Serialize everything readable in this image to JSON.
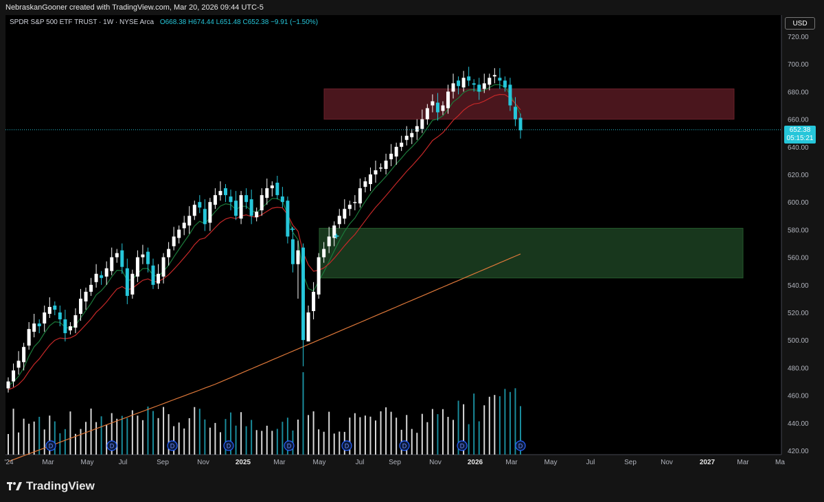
{
  "credit": "NebraskanGooner created with TradingView.com, Mar 20, 2026 09:44 UTC-5",
  "brand": "TradingView",
  "legend": {
    "symbol": "SPDR S&P 500 ETF TRUST · 1W · NYSE Arca",
    "ohlc": "O668.38 H674.44 L651.48 C652.38 −9.91 (−1.50%)"
  },
  "currency": "USD",
  "price_tag": {
    "price": "652.38",
    "countdown": "05:15:21"
  },
  "colors": {
    "up": "#ffffff",
    "down": "#26c6da",
    "ema_fast": "#1b7a3a",
    "ema_mid": "#c62828",
    "ema_slow": "#e0793a",
    "resistance_zone": "#4a161d",
    "support_zone": "#18371d",
    "dividend_marker": "#2962ff",
    "background": "#000000"
  },
  "chart_data": {
    "type": "candlestick",
    "symbol": "SPDR S&P 500 ETF TRUST",
    "interval": "1W",
    "exchange": "NYSE Arca",
    "y_axis": {
      "side": "right",
      "ylim": [
        415,
        728
      ],
      "ticks": [
        420,
        440,
        460,
        480,
        500,
        520,
        540,
        560,
        580,
        600,
        620,
        640,
        660,
        680,
        700,
        720
      ],
      "tick_labels": [
        "420.00",
        "440.00",
        "460.00",
        "480.00",
        "500.00",
        "520.00",
        "540.00",
        "560.00",
        "580.00",
        "600.00",
        "620.00",
        "640.00",
        "660.00",
        "680.00",
        "700.00",
        "720.00"
      ]
    },
    "x_axis": {
      "labels": [
        "'24",
        "Mar",
        "May",
        "Jul",
        "Sep",
        "Nov",
        "2025",
        "Mar",
        "May",
        "Jul",
        "Sep",
        "Nov",
        "2026",
        "Mar",
        "May",
        "Jul",
        "Sep",
        "Nov",
        "2027",
        "Mar",
        "Ma"
      ],
      "bold_labels": [
        "2025",
        "2026",
        "2027"
      ]
    },
    "last_close": 652.38,
    "zones": [
      {
        "name": "resistance",
        "from": 660,
        "to": 682,
        "start": "2025-08",
        "extends_right": true
      },
      {
        "name": "support",
        "from": 545,
        "to": 581,
        "start": "2025-04",
        "extends_right": true
      }
    ],
    "series": [
      {
        "type": "candlestick",
        "approx_closes": [
          470,
          478,
          485,
          495,
          508,
          512,
          510,
          520,
          524,
          522,
          515,
          505,
          510,
          518,
          530,
          535,
          540,
          548,
          545,
          552,
          560,
          563,
          553,
          532,
          548,
          560,
          562,
          555,
          540,
          548,
          560,
          566,
          575,
          580,
          585,
          590,
          598,
          596,
          584,
          600,
          605,
          608,
          605,
          600,
          590,
          605,
          600,
          590,
          593,
          605,
          610,
          612,
          605,
          600,
          575,
          555,
          565,
          500,
          520,
          535,
          560,
          566,
          575,
          583,
          590,
          595,
          598,
          600,
          610,
          615,
          620,
          623,
          625,
          630,
          635,
          640,
          643,
          648,
          650,
          655,
          660,
          668,
          673,
          665,
          670,
          680,
          686,
          684,
          690,
          688,
          685,
          680,
          686,
          690,
          692,
          688,
          683,
          670,
          660,
          652
        ]
      },
      {
        "type": "line",
        "name": "",
        "color": "#1b7a3a"
      },
      {
        "type": "line",
        "name": "",
        "color": "#c62828"
      },
      {
        "type": "line",
        "name": "",
        "color": "#e0793a"
      },
      {
        "type": "volume"
      }
    ],
    "markers": [
      {
        "type": "dividend",
        "label": "D",
        "count": 9
      },
      {
        "type": "cross",
        "label": "+",
        "count": 2
      }
    ]
  }
}
